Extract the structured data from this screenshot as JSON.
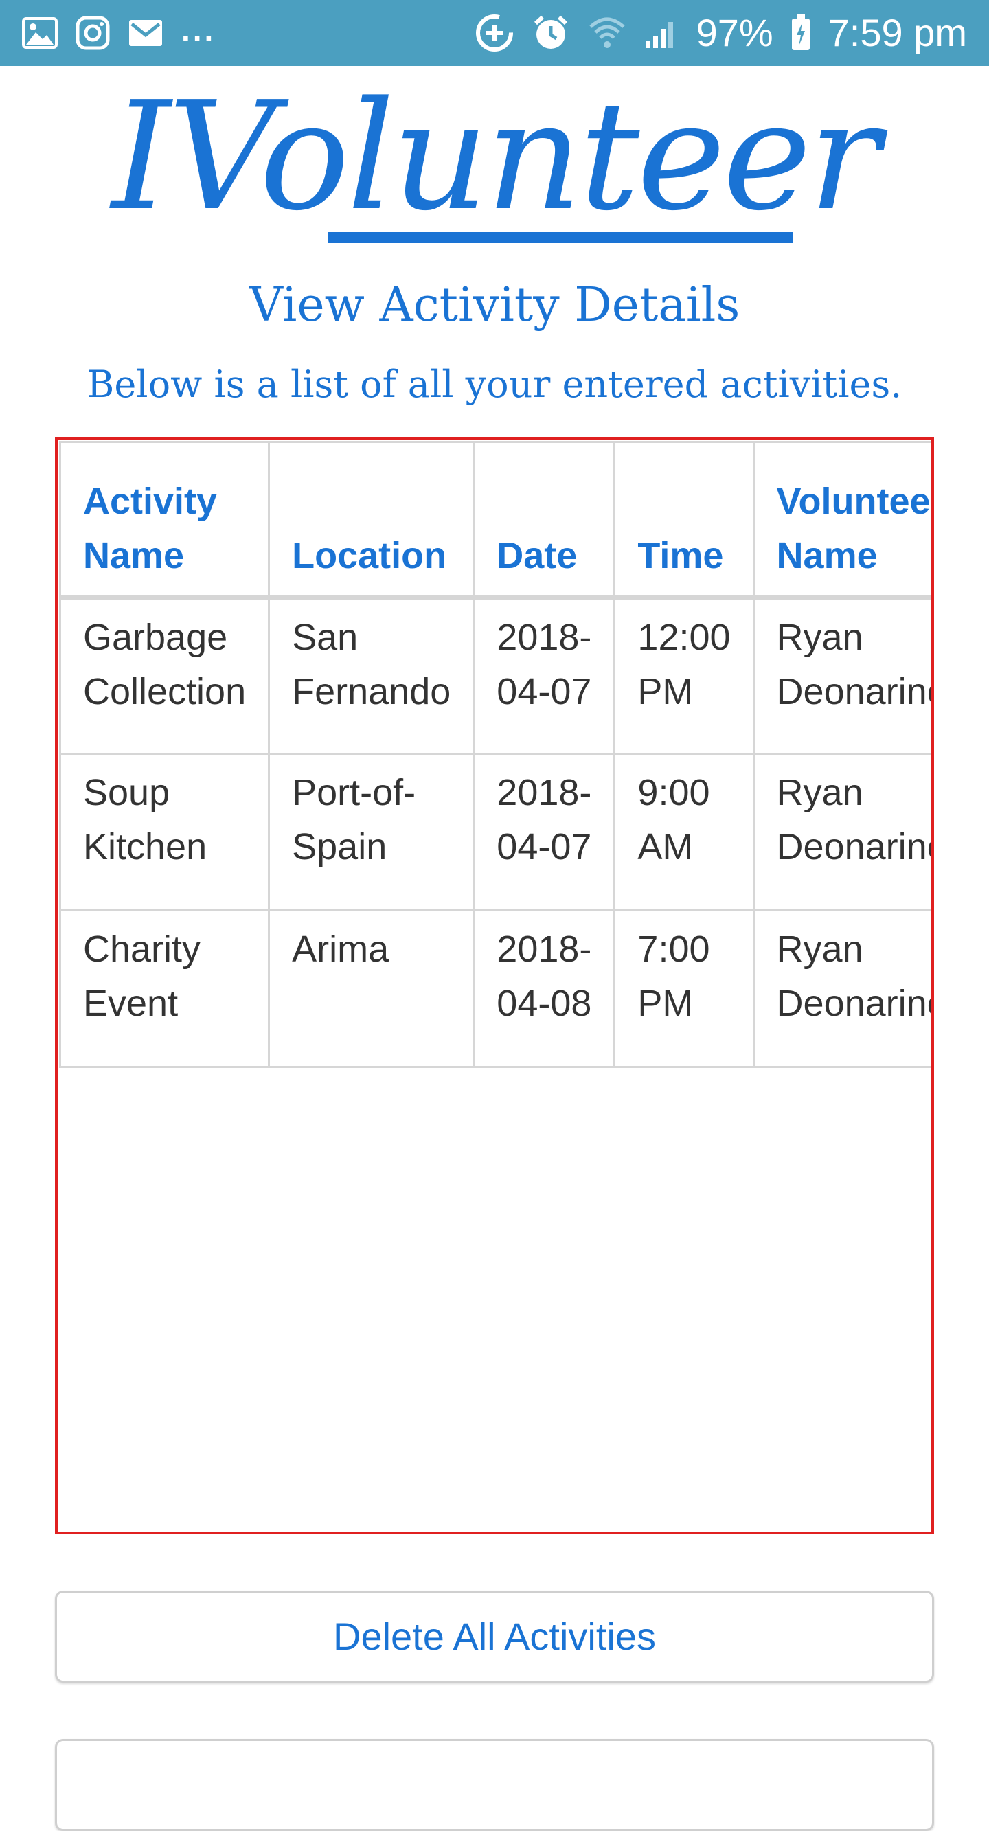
{
  "status_bar": {
    "battery": "97%",
    "time": "7:59 pm",
    "more": "..."
  },
  "app": {
    "logo_text": "IVolunteer"
  },
  "page": {
    "title": "View Activity Details",
    "subtitle": "Below is a list of all your entered activities."
  },
  "table": {
    "headers": [
      "Activity Name",
      "Location",
      "Date",
      "Time",
      "Volunteer Name"
    ],
    "rows": [
      [
        "Garbage Collection",
        "San Fernando",
        "2018-04-07",
        "12:00 PM",
        "Ryan Deonarine"
      ],
      [
        "Soup Kitchen",
        "Port-of-Spain",
        "2018-04-07",
        "9:00 AM",
        "Ryan Deonarine"
      ],
      [
        "Charity Event",
        "Arima",
        "2018-04-08",
        "7:00 PM",
        "Ryan Deonarine"
      ]
    ]
  },
  "buttons": {
    "delete_all": "Delete All Activities",
    "second": ""
  },
  "colors": {
    "status_bar": "#4b9fc0",
    "accent": "#1a73d4",
    "table_border": "#e02020"
  }
}
